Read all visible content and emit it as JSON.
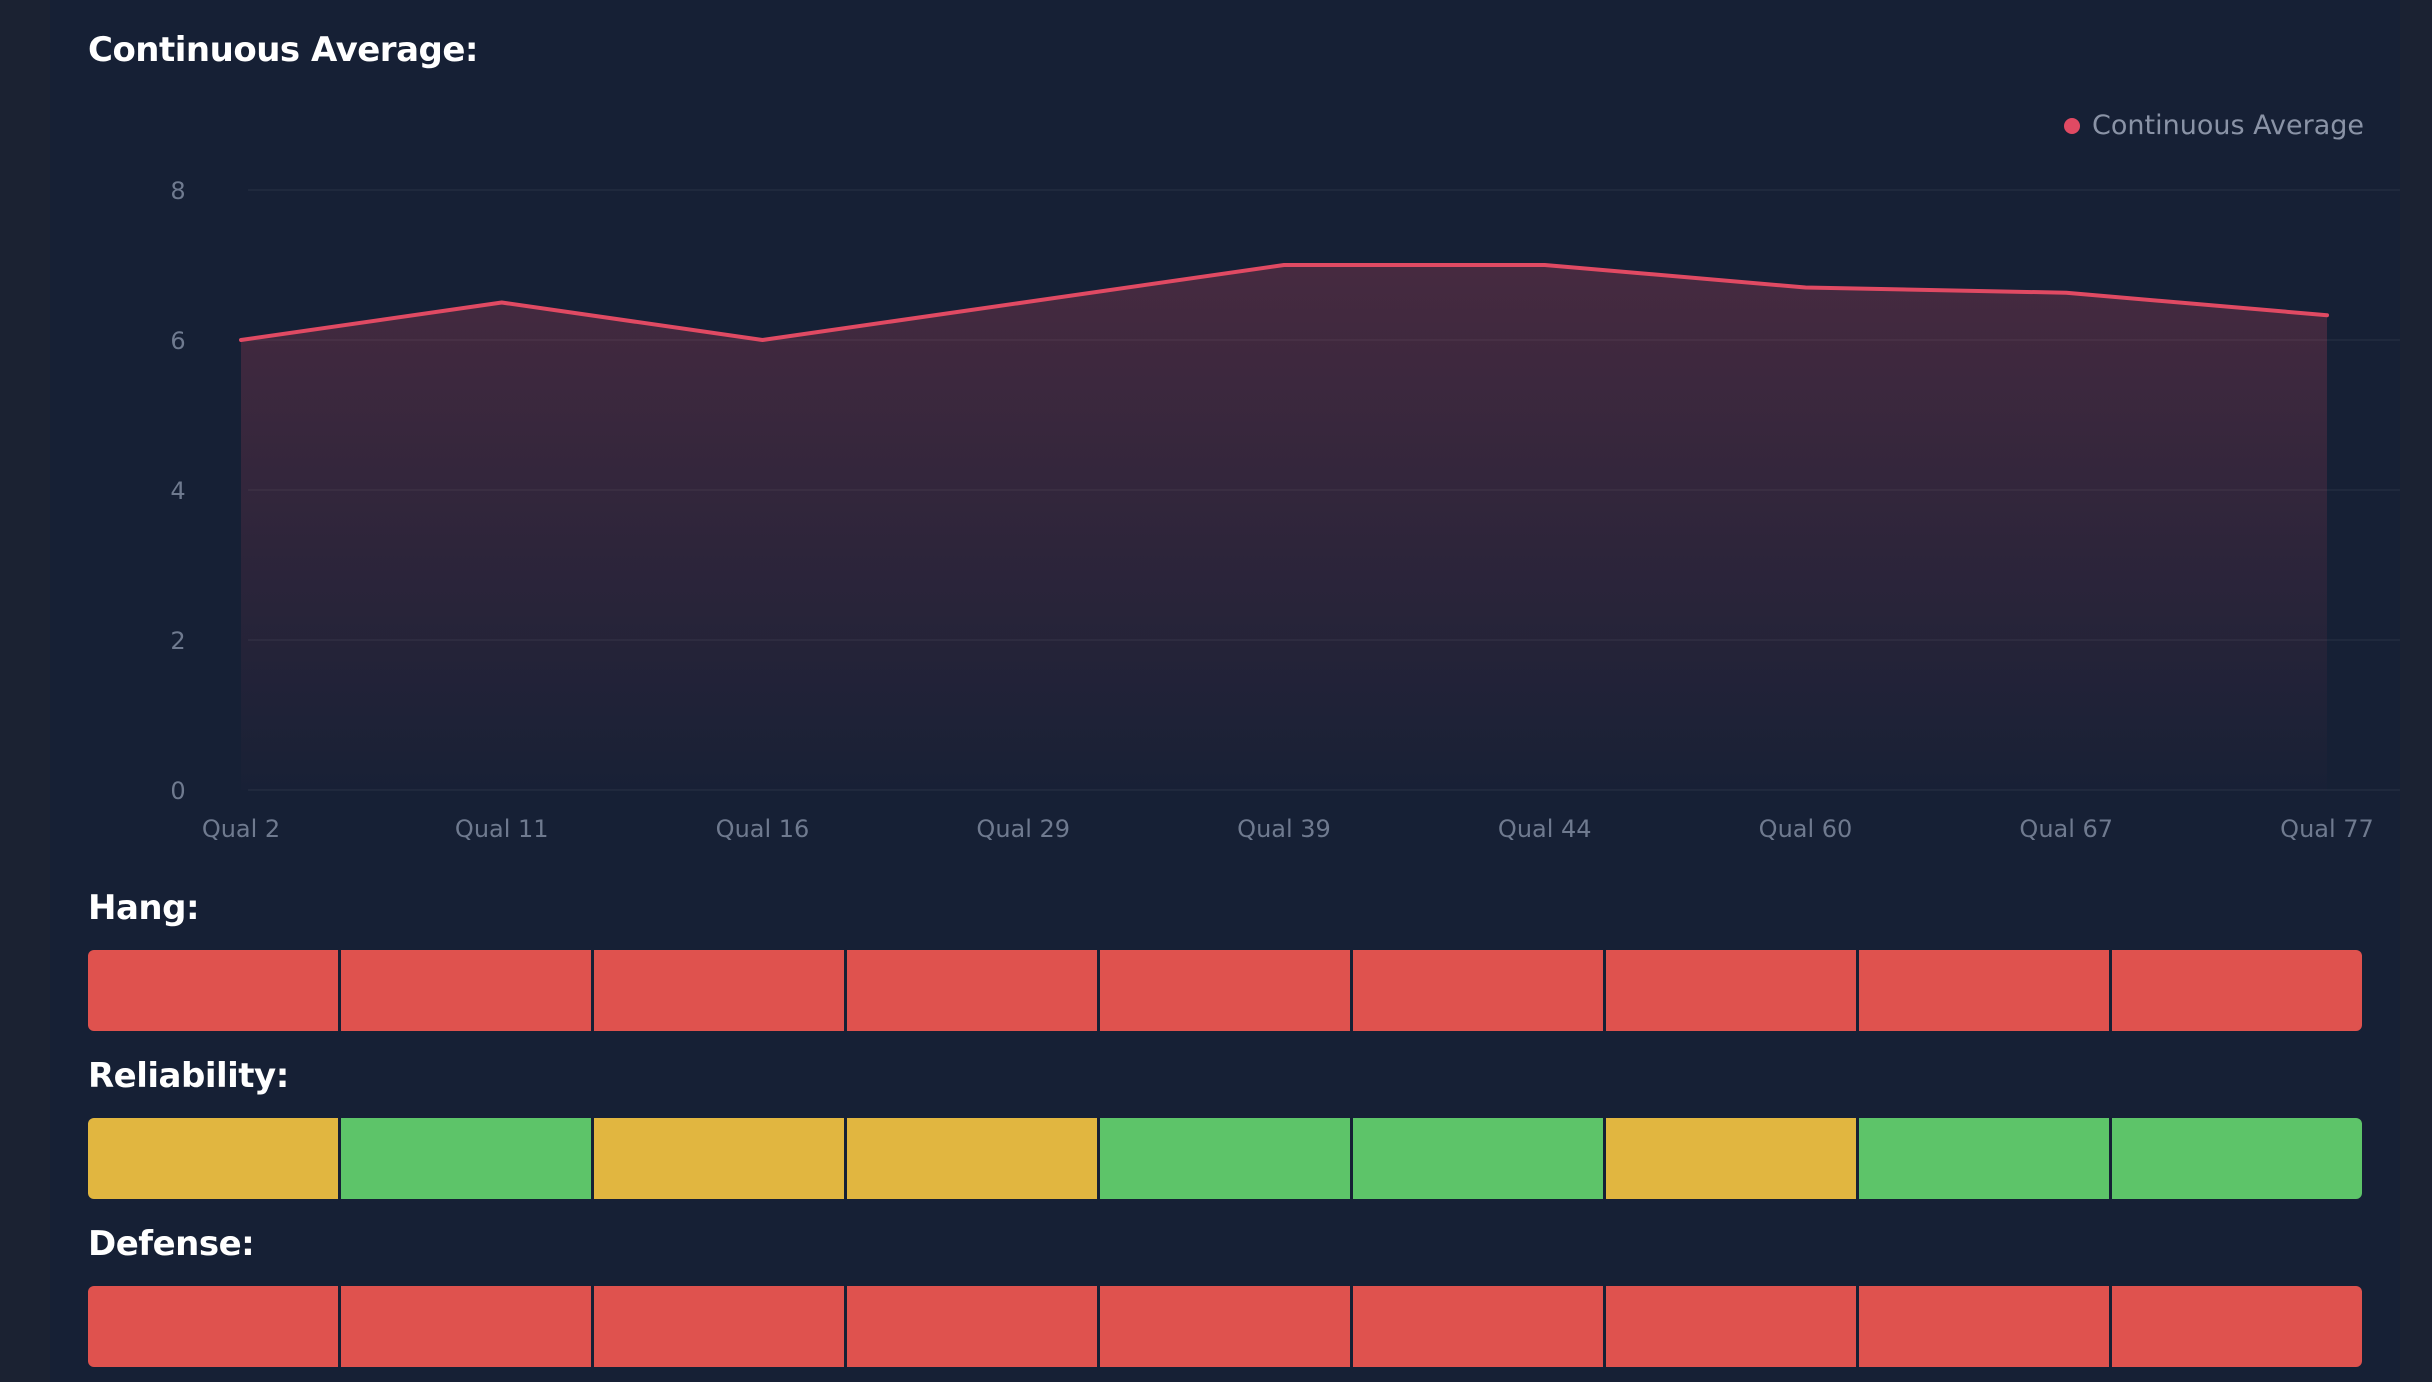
{
  "chart_title": "Continuous Average:",
  "chart_data": {
    "type": "area",
    "title": "Continuous Average:",
    "categories": [
      "Qual 2",
      "Qual 11",
      "Qual 16",
      "Qual 29",
      "Qual 39",
      "Qual 44",
      "Qual 60",
      "Qual 67",
      "Qual 77"
    ],
    "series": [
      {
        "name": "Continuous Average",
        "values": [
          6.0,
          6.5,
          6.0,
          6.5,
          7.0,
          7.0,
          6.7,
          6.63,
          6.33
        ]
      }
    ],
    "ylim": [
      0,
      8
    ],
    "yticks": [
      "0",
      "2",
      "4",
      "6",
      "8"
    ],
    "xlabel": "",
    "ylabel": "",
    "grid": true,
    "legend": "top-right",
    "color": "#e04a63"
  },
  "rows": [
    {
      "label": "Hang:",
      "cells": [
        "#df524e",
        "#df524e",
        "#df524e",
        "#df524e",
        "#df524e",
        "#df524e",
        "#df524e",
        "#df524e",
        "#df524e"
      ]
    },
    {
      "label": "Reliability:",
      "cells": [
        "#e1b640",
        "#5dc469",
        "#e1b640",
        "#e1b640",
        "#5dc469",
        "#5dc469",
        "#e1b640",
        "#5dc469",
        "#5dc469"
      ]
    },
    {
      "label": "Defense:",
      "cells": [
        "#df524e",
        "#df524e",
        "#df524e",
        "#df524e",
        "#df524e",
        "#df524e",
        "#df524e",
        "#df524e",
        "#df524e"
      ]
    }
  ]
}
